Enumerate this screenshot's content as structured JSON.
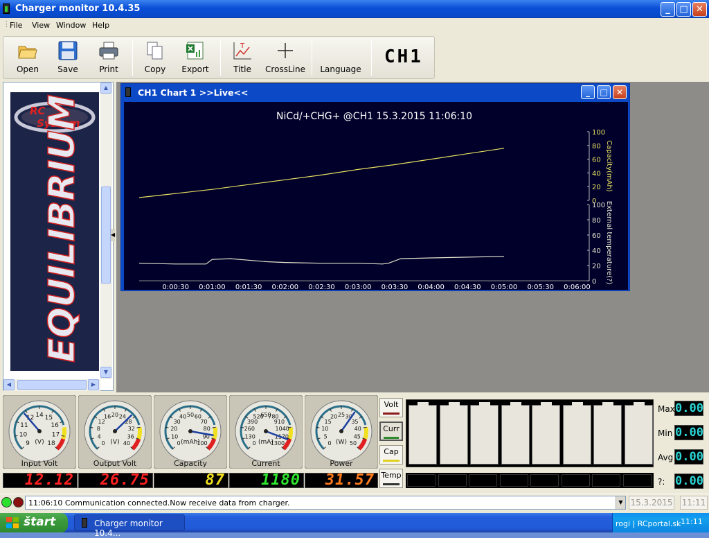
{
  "window": {
    "title": "Charger monitor 10.4.35",
    "min": "_",
    "max": "□",
    "close": "✕"
  },
  "menu": [
    "File",
    "View",
    "Window",
    "Help"
  ],
  "toolbar": {
    "open": "Open",
    "save": "Save",
    "print": "Print",
    "copy": "Copy",
    "export": "Export",
    "title": "Title",
    "crossline": "CrossLine",
    "language": "Language",
    "channel": "CH1"
  },
  "chart_window": {
    "title": "CH1 Chart 1 >>Live<<"
  },
  "chart_data": {
    "type": "line",
    "title": "NiCd/+CHG+    @CH1  15.3.2015  11:06:10",
    "x_ticks": [
      "0:00:30",
      "0:01:00",
      "0:01:30",
      "0:02:00",
      "0:02:30",
      "0:03:00",
      "0:03:30",
      "0:04:00",
      "0:04:30",
      "0:05:00",
      "0:05:30",
      "0:06:00"
    ],
    "series": [
      {
        "name": "Capacity(mAh)",
        "color": "#e8e060",
        "x_sec": [
          0,
          30,
          60,
          90,
          120,
          150,
          180,
          210,
          240,
          270,
          300
        ],
        "values": [
          4,
          10,
          16,
          23,
          30,
          37,
          45,
          52,
          60,
          68,
          76
        ],
        "ylim": [
          0,
          100
        ],
        "y_ticks": [
          0,
          20,
          40,
          60,
          80,
          100
        ]
      },
      {
        "name": "External temperature(?)",
        "color": "#e6e6d0",
        "x_sec": [
          0,
          30,
          55,
          60,
          75,
          90,
          105,
          120,
          150,
          180,
          200,
          205,
          215,
          240,
          270,
          300
        ],
        "values": [
          23,
          22,
          22,
          28,
          29,
          27,
          25,
          24,
          23,
          23,
          22,
          23,
          29,
          30,
          31,
          32
        ],
        "ylim": [
          0,
          100
        ],
        "y_ticks": [
          0,
          20,
          40,
          60,
          80,
          100
        ]
      }
    ],
    "xlim_sec": [
      0,
      370
    ],
    "grid": false
  },
  "gauges": [
    {
      "label": "Input Volt",
      "unit": "(V)",
      "ticks": [
        "9",
        "10",
        "11",
        "12",
        "14",
        "15",
        "16",
        "17",
        "18"
      ],
      "display": "12.12",
      "color": "#ff2020",
      "needle": 0.35
    },
    {
      "label": "Output Volt",
      "unit": "(V)",
      "ticks": [
        "0",
        "4",
        "8",
        "12",
        "16",
        "20",
        "24",
        "28",
        "32",
        "36",
        "40"
      ],
      "display": "26.75",
      "color": "#ff2020",
      "needle": 0.67
    },
    {
      "label": "Capacity",
      "unit": "(mAh)",
      "ticks": [
        "0",
        "10",
        "20",
        "30",
        "40",
        "50",
        "60",
        "70",
        "80",
        "90",
        "100"
      ],
      "display": "87",
      "color": "#f0e020",
      "needle": 0.87
    },
    {
      "label": "Current",
      "unit": "(mA)",
      "ticks": [
        "0",
        "130",
        "260",
        "390",
        "520",
        "650",
        "780",
        "910",
        "1040",
        "1170",
        "1300"
      ],
      "display": "1180",
      "color": "#2ee82e",
      "needle": 0.91
    },
    {
      "label": "Power",
      "unit": "(W)",
      "ticks": [
        "0",
        "5",
        "10",
        "15",
        "20",
        "25",
        "30",
        "35",
        "40",
        "45",
        "50"
      ],
      "display": "31.57",
      "color": "#ff7a1a",
      "needle": 0.63
    }
  ],
  "selectors": [
    {
      "label": "Volt",
      "color": "#8b1a1a"
    },
    {
      "label": "Curr",
      "color": "#2e8b2e"
    },
    {
      "label": "Cap",
      "color": "#e0d020"
    },
    {
      "label": "Temp",
      "color": "#333333"
    }
  ],
  "stats": [
    {
      "label": "Max",
      "value": "0.00"
    },
    {
      "label": "Min",
      "value": "0.00"
    },
    {
      "label": "Avg",
      "value": "0.00"
    },
    {
      "label": "?:",
      "value": "0.00"
    }
  ],
  "status": {
    "message": "11:06:10  Communication connected.Now receive data from charger.",
    "date": "15.3.2015",
    "time": "11:11"
  },
  "taskbar": {
    "start": "štart",
    "task": "Charger monitor 10.4...",
    "tray_text": "rogi | RCportal.sk",
    "clock": "11:11"
  }
}
